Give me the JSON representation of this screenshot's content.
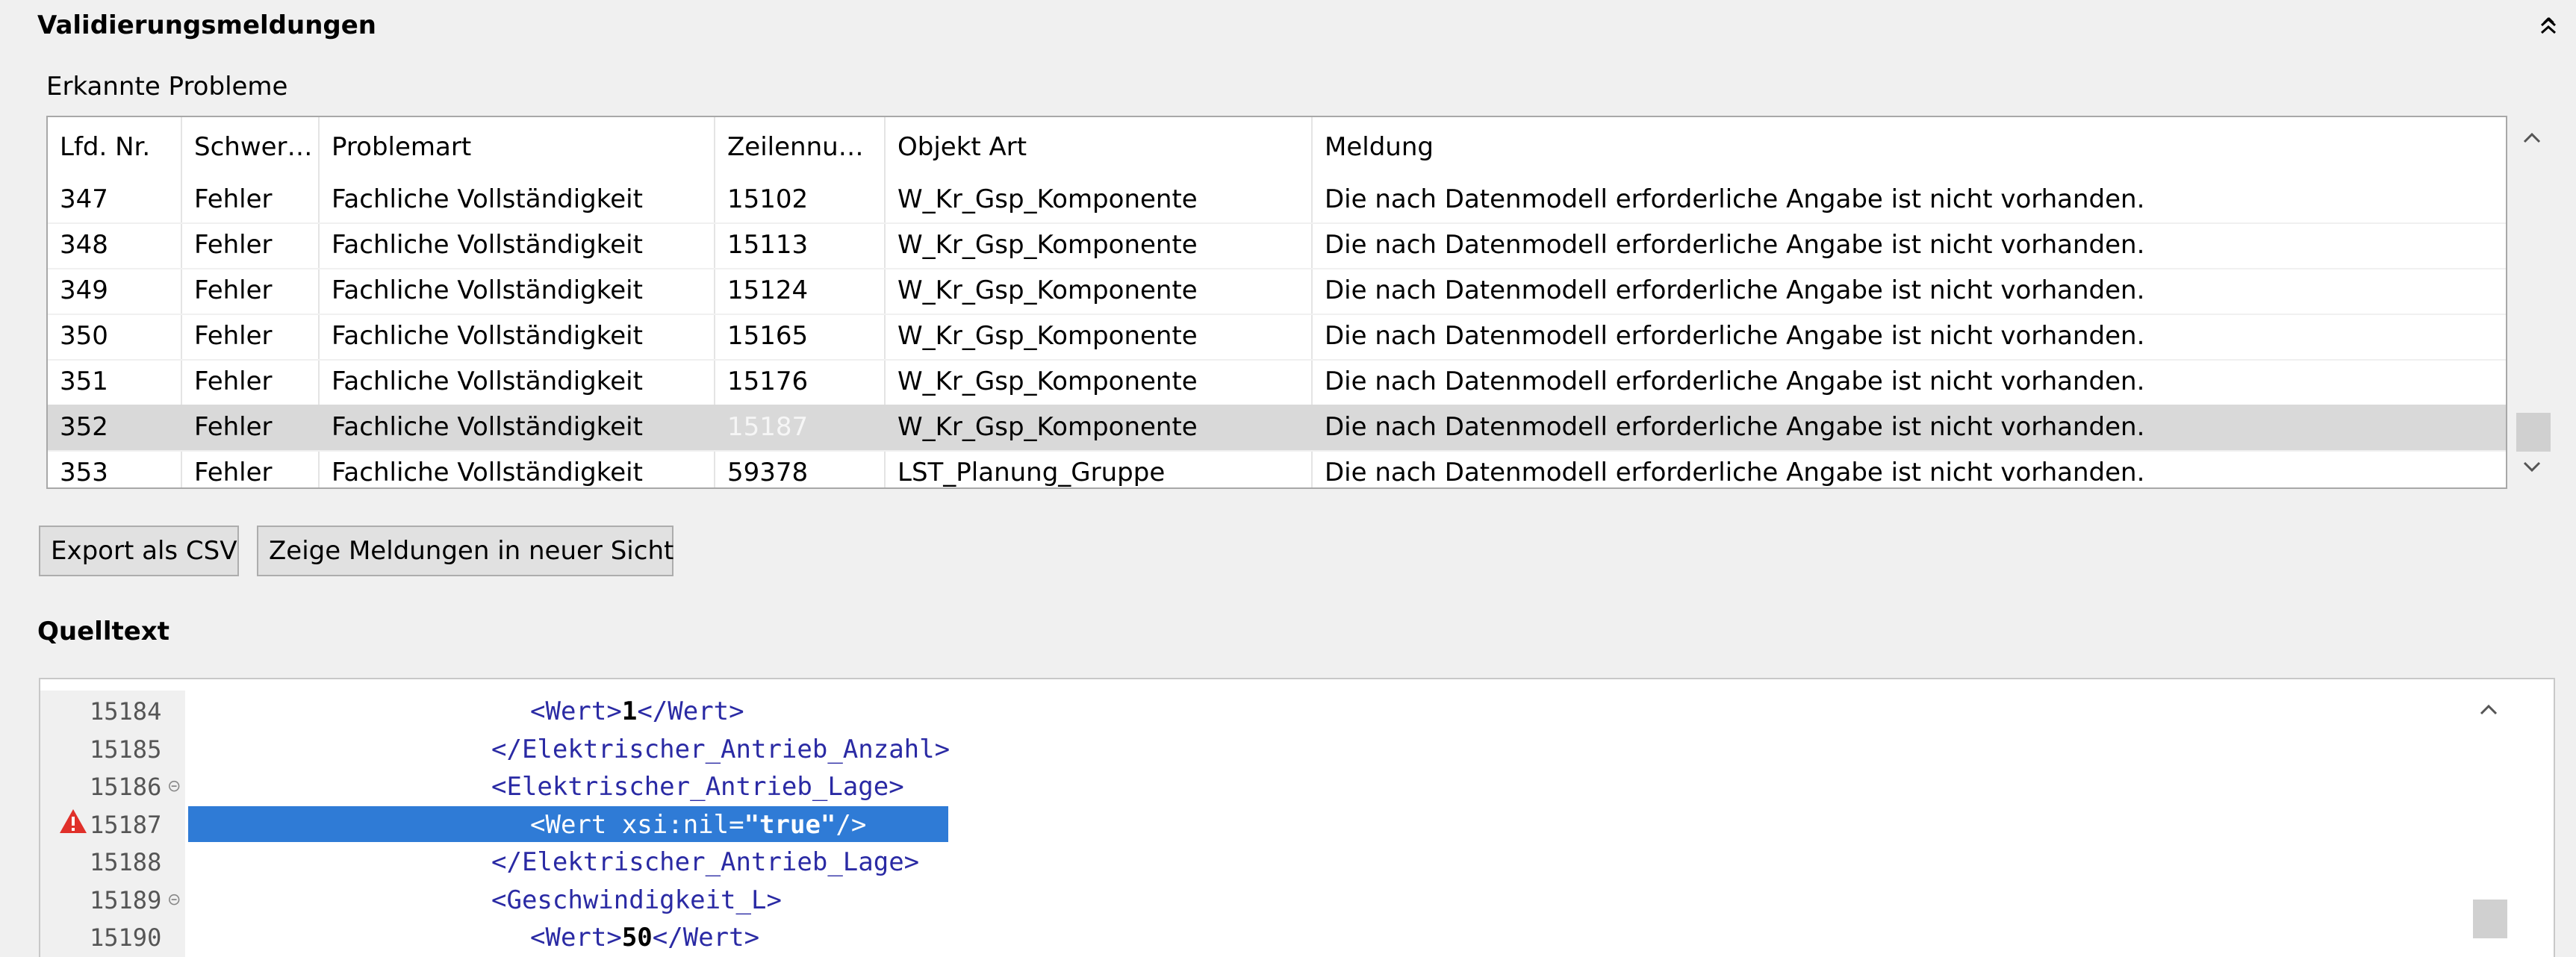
{
  "validation": {
    "title": "Validierungsmeldungen",
    "subtitle": "Erkannte Probleme",
    "columns": [
      "Lfd. Nr.",
      "Schwer…",
      "Problemart",
      "Zeilennu…",
      "Objekt Art",
      "Meldung"
    ],
    "rows": [
      {
        "nr": "347",
        "severity": "Fehler",
        "type": "Fachliche Vollständigkeit",
        "line": "15102",
        "object": "W_Kr_Gsp_Komponente",
        "message": "Die nach Datenmodell erforderliche Angabe ist nicht vorhanden."
      },
      {
        "nr": "348",
        "severity": "Fehler",
        "type": "Fachliche Vollständigkeit",
        "line": "15113",
        "object": "W_Kr_Gsp_Komponente",
        "message": "Die nach Datenmodell erforderliche Angabe ist nicht vorhanden."
      },
      {
        "nr": "349",
        "severity": "Fehler",
        "type": "Fachliche Vollständigkeit",
        "line": "15124",
        "object": "W_Kr_Gsp_Komponente",
        "message": "Die nach Datenmodell erforderliche Angabe ist nicht vorhanden."
      },
      {
        "nr": "350",
        "severity": "Fehler",
        "type": "Fachliche Vollständigkeit",
        "line": "15165",
        "object": "W_Kr_Gsp_Komponente",
        "message": "Die nach Datenmodell erforderliche Angabe ist nicht vorhanden."
      },
      {
        "nr": "351",
        "severity": "Fehler",
        "type": "Fachliche Vollständigkeit",
        "line": "15176",
        "object": "W_Kr_Gsp_Komponente",
        "message": "Die nach Datenmodell erforderliche Angabe ist nicht vorhanden."
      },
      {
        "nr": "352",
        "severity": "Fehler",
        "type": "Fachliche Vollständigkeit",
        "line": "15187",
        "object": "W_Kr_Gsp_Komponente",
        "message": "Die nach Datenmodell erforderliche Angabe ist nicht vorhanden."
      },
      {
        "nr": "353",
        "severity": "Fehler",
        "type": "Fachliche Vollständigkeit",
        "line": "59378",
        "object": "LST_Planung_Gruppe",
        "message": "Die nach Datenmodell erforderliche Angabe ist nicht vorhanden."
      }
    ],
    "selected_row": "352"
  },
  "buttons": {
    "export_csv": "Export als CSV",
    "show_in_view": "Zeige Meldungen in neuer Sicht"
  },
  "source": {
    "title": "Quelltext",
    "lines": [
      {
        "num": "15184",
        "indent": 3,
        "tag_open": "<Wert>",
        "value": "1",
        "tag_close": "</Wert>"
      },
      {
        "num": "15185",
        "indent": 2,
        "text": "</Elektrischer_Antrieb_Anzahl>"
      },
      {
        "num": "15186",
        "indent": 2,
        "text": "<Elektrischer_Antrieb_Lage>",
        "fold": true
      },
      {
        "num": "15187",
        "indent": 3,
        "pre": "<Wert xsi:nil=",
        "value": "\"true\"",
        "post": "/>",
        "highlighted": true,
        "warning": true
      },
      {
        "num": "15188",
        "indent": 2,
        "text": "</Elektrischer_Antrieb_Lage>"
      },
      {
        "num": "15189",
        "indent": 2,
        "text": "<Geschwindigkeit_L>",
        "fold": true
      },
      {
        "num": "15190",
        "indent": 3,
        "tag_open": "<Wert>",
        "value": "50",
        "tag_close": "</Wert>"
      }
    ]
  },
  "colors": {
    "highlight": "#2f7bd6",
    "xml_tag": "#2a2aa4",
    "warning": "#e0302a",
    "selected_row": "#d9d9d9"
  },
  "icons": [
    "collapse-up-icon",
    "scroll-up-icon",
    "scroll-down-icon",
    "warning-icon",
    "fold-icon"
  ]
}
